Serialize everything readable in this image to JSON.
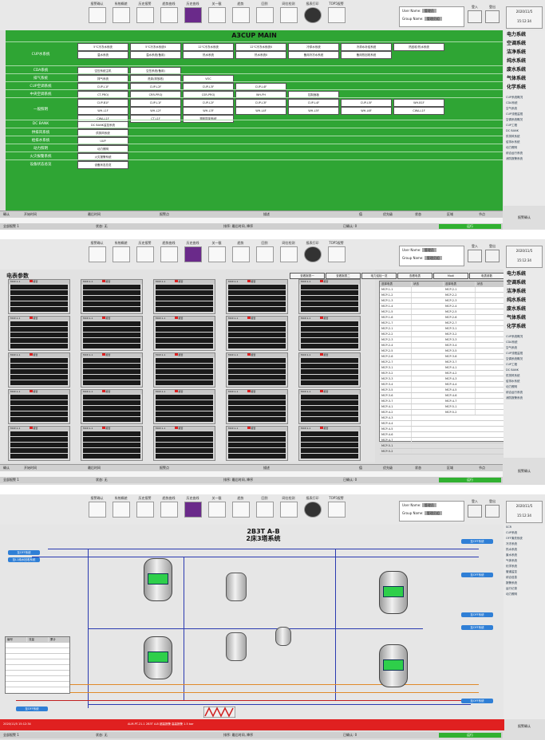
{
  "toolbar": {
    "buttons": [
      "报警确认",
      "系统概貌",
      "历史报警",
      "趋势曲线",
      "历史曲线",
      "关一截",
      "趋势",
      "回到",
      "网位检测",
      "报表打印",
      "TOP5报警"
    ]
  },
  "user": {
    "user_label": "User Name:",
    "user_value": "管理员",
    "group_label": "Group Name:",
    "group_value": "管理员组",
    "login": "登入",
    "logout": "登出"
  },
  "clock": {
    "date": "2020/11/5",
    "time": "15:12:34"
  },
  "sidebar": {
    "systems": [
      "电力系统",
      "空调系统",
      "洁净系统",
      "纯水系统",
      "废水系统",
      "气体系统",
      "化学系统"
    ],
    "links_p1": [
      "CUP系统概况",
      "CDA系统",
      "空气系统",
      "CUP流程监视",
      "空调系统概况",
      "CUP工程",
      "DC BANK",
      "供排风系统",
      "给排水系统",
      "动力照明",
      "综合运行系统",
      "消防报警系统"
    ],
    "links_p3": [
      "SCR",
      "CUP系统",
      "OFF清洗系统",
      "冷冻系统",
      "热水系统",
      "废水系统",
      "气体系统",
      "化学系统",
      "管道监控",
      "综合信息",
      "报警系统",
      "运行记录",
      "动力照明"
    ]
  },
  "panel1": {
    "title": "A3CUP MAIN",
    "rows": [
      {
        "label": "CUP水系统",
        "buttons": [
          "5℃冷冻水系统",
          "5℃冷冻水系统II",
          "12℃冷冻水系统",
          "12℃冷冻水系统II",
          "冷却水系统",
          "冷却水补给系统",
          "热回收/热水系统",
          "温水系统",
          "温水系统(备用)",
          "热水系统",
          "热水系统II",
          "备用冷冻水系统",
          "备用热回收系统"
        ]
      },
      {
        "label": "CDA系统",
        "buttons": [
          "空压系统主机",
          "空压系统(备用)"
        ]
      },
      {
        "label": "排气系统",
        "buttons": [
          "排气系统",
          "洗涤(排放塔)",
          "VOC"
        ]
      },
      {
        "label": "CUP空调系统",
        "buttons": [
          "CUP-L1F",
          "CUP-L2F",
          "CUP-L3F",
          "CUP-L4F"
        ]
      },
      {
        "label": "中央空调系统",
        "buttons": [
          "CT-PROJ",
          "CRR-PROJ",
          "CSR-PROJ",
          "WH-PH",
          "控制面板"
        ]
      },
      {
        "label": "一般照明",
        "buttons": [
          "CUP-B1F",
          "CUP-L1F",
          "CUP-L2F",
          "CUP-L3F",
          "CUP-L4F",
          "CUP-L5F",
          "WH-B1F",
          "WH-L1F",
          "WH-L2F",
          "WH-L3F",
          "WH-L4F",
          "WH-L5F",
          "WH-L6F",
          "CWA-L1F",
          "CWA-L1F",
          "CT-L1F",
          "照明控制系统"
        ]
      },
      {
        "label": "DC BANK",
        "buttons": [
          "DC BANK监控系统"
        ]
      },
      {
        "label": "供排风系统",
        "buttons": [
          "供排风系统"
        ]
      },
      {
        "label": "给排水系统",
        "buttons": [
          "UUP"
        ]
      },
      {
        "label": "动力照明",
        "buttons": [
          "动力照明"
        ]
      },
      {
        "label": "火灾报警系统",
        "buttons": [
          "火灾报警系统"
        ]
      },
      {
        "label": "设备状态总览",
        "buttons": [
          "设备状态总览"
        ]
      }
    ]
  },
  "alarm": {
    "headers": [
      "确认",
      "开始时间",
      "最后时间",
      "报警点",
      "描述",
      "值",
      "优先级",
      "状态",
      "区域",
      "节点"
    ],
    "status_left": "全部报警 1",
    "status_mid": "状态: 无",
    "status_sort": "排序: 最后时间, 降序",
    "status_count": "已确认: 0",
    "status_green": "运行",
    "alarm_button": "报警确认"
  },
  "panel2": {
    "title": "电表参数",
    "tabs": [
      "查看报表一",
      "查看报表二",
      "电力巡检一览",
      "查看电表",
      "Modi",
      "电表参数"
    ],
    "cell_title": "MCP-1-1",
    "cell_alarm_label": "报警",
    "list_cols": [
      "选择电表",
      "状态",
      "选择电表",
      "状态"
    ],
    "list_rows": [
      "MCP-1-1",
      "MCP-1-2",
      "MCP-1-3",
      "MCP-1-4",
      "MCP-1-5",
      "MCP-1-6",
      "MCP-1-7",
      "MCP-2-1",
      "MCP-2-2",
      "MCP-2-3",
      "MCP-2-4",
      "MCP-2-5",
      "MCP-2-6",
      "MCP-2-7",
      "MCP-3-1",
      "MCP-3-2",
      "MCP-3-3",
      "MCP-3-4",
      "MCP-3-5",
      "MCP-3-6",
      "MCP-3-7",
      "MCP-4-1",
      "MCP-4-2",
      "MCP-4-3",
      "MCP-4-4",
      "MCP-4-5",
      "MCP-4-6",
      "MCP-4-7",
      "MCP-5-1",
      "MCP-5-2"
    ]
  },
  "panel3": {
    "title": "2B3T A-B",
    "subtitle": "2床3塔系统",
    "side_labels_left": [
      "至OFF系统",
      "至L1纯水回收系统"
    ],
    "side_labels_right": [
      "至OFF系统",
      "至OFF系统",
      "至OFF系统",
      "至OFF系统",
      "至OFF系统"
    ],
    "table_headers": [
      "编号",
      "流量",
      "累计"
    ],
    "red_alarm": "ALM-PT-21-1 2B3T A-B  超高报警  高高报警 1.5 bar",
    "red_date": "2020/11/5 15:12:34"
  }
}
